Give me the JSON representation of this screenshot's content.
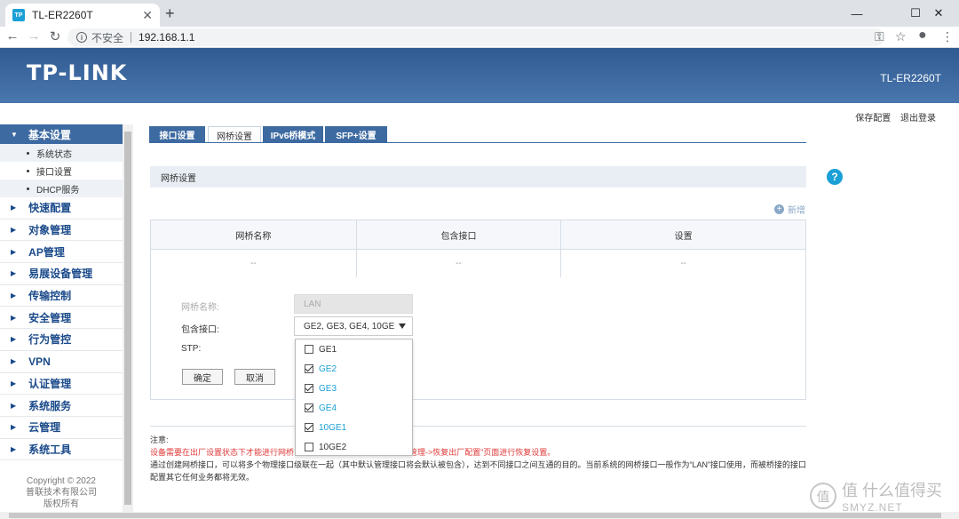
{
  "browser": {
    "tab_title": "TL-ER2260T",
    "tab_favicon": "TP",
    "tab_close": "✕",
    "new_tab": "+",
    "insecure_label": "不安全",
    "url": "192.168.1.1"
  },
  "header": {
    "logo": "TP-LINK",
    "model": "TL-ER2260T",
    "save_config": "保存配置",
    "logout": "退出登录"
  },
  "sidebar": {
    "expanded": {
      "label": "基本设置",
      "subitems": [
        "系统状态",
        "接口设置",
        "DHCP服务"
      ]
    },
    "items": [
      "快速配置",
      "对象管理",
      "AP管理",
      "易展设备管理",
      "传输控制",
      "安全管理",
      "行为管控",
      "VPN",
      "认证管理",
      "系统服务",
      "云管理",
      "系统工具"
    ],
    "copyright": [
      "Copyright © 2022",
      "普联技术有限公司",
      "版权所有"
    ]
  },
  "tabs": [
    "接口设置",
    "网桥设置",
    "IPv6桥模式",
    "SFP+设置"
  ],
  "active_tab": "网桥设置",
  "panel": {
    "title": "网桥设置",
    "help": "?",
    "add_new": "新增",
    "table": {
      "headers": [
        "网桥名称",
        "包含接口",
        "设置"
      ],
      "row": [
        "--",
        "--",
        "--"
      ]
    },
    "form": {
      "bridge_name_label": "网桥名称:",
      "bridge_name_value": "LAN",
      "ports_label": "包含接口:",
      "ports_value": "GE2, GE3, GE4, 10GE",
      "stp_label": "STP:",
      "ok_button": "确定",
      "cancel_button": "取消"
    },
    "dropdown_options": [
      {
        "label": "GE1",
        "checked": false
      },
      {
        "label": "GE2",
        "checked": true
      },
      {
        "label": "GE3",
        "checked": true
      },
      {
        "label": "GE4",
        "checked": true
      },
      {
        "label": "10GE1",
        "checked": true
      },
      {
        "label": "10GE2",
        "checked": false
      }
    ]
  },
  "notes": {
    "title": "注意:",
    "red_left": "设备需要在出厂设置状态下才能进行网桥",
    "red_right": "管理->恢复出厂配置”页面进行恢复设置。",
    "black": "通过创建网桥接口，可以将多个物理接口级联在一起（其中默认管理接口将会默认被包含），达到不同接口之间互通的目的。当前系统的网桥接口一般作为“LAN”接口使用，而被桥接的接口配置其它任何业务都将无效。"
  },
  "watermark": {
    "line1": "值 什么值得买",
    "line2": "SMYZ.NET"
  },
  "colors": {
    "header": "#3d6aa1",
    "accent": "#1aa0d6",
    "warning": "#e03a3a"
  }
}
